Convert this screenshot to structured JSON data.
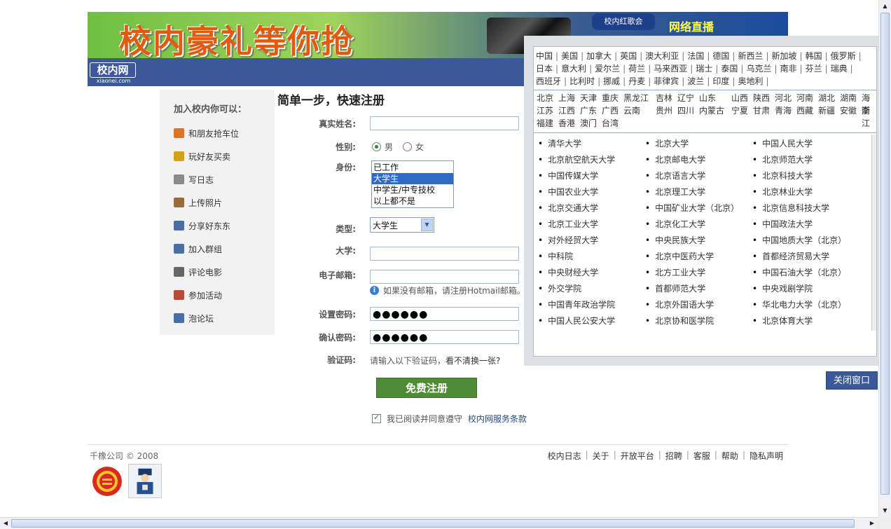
{
  "banner": {
    "text": "校内豪礼等你抢",
    "badge": "校内红歌会",
    "right_text": "网络直播"
  },
  "logo": {
    "main": "校内网",
    "sub": "xiaonei.com"
  },
  "sidebar": {
    "title": "加入校内你可以：",
    "items": [
      {
        "label": "和朋友抢车位",
        "icon": "car-icon",
        "color": "#d9732a"
      },
      {
        "label": "玩好友买卖",
        "icon": "people-trade-icon",
        "color": "#d4a21a"
      },
      {
        "label": "写日志",
        "icon": "notebook-icon",
        "color": "#8a8a8a"
      },
      {
        "label": "上传照片",
        "icon": "photo-icon",
        "color": "#9a6a3a"
      },
      {
        "label": "分享好东东",
        "icon": "share-icon",
        "color": "#4a6fa5"
      },
      {
        "label": "加入群组",
        "icon": "group-icon",
        "color": "#4a6fa5"
      },
      {
        "label": "评论电影",
        "icon": "film-icon",
        "color": "#666666"
      },
      {
        "label": "参加活动",
        "icon": "calendar-icon",
        "color": "#b84a3a"
      },
      {
        "label": "泡论坛",
        "icon": "forum-icon",
        "color": "#4a6fa5"
      }
    ]
  },
  "form": {
    "title": "简单一步，快速注册",
    "labels": {
      "name": "真实姓名:",
      "gender": "性别:",
      "identity": "身份:",
      "type": "类型:",
      "university": "大学:",
      "email": "电子邮箱:",
      "password": "设置密码:",
      "confirm": "确认密码:",
      "captcha": "验证码:"
    },
    "gender_male": "男",
    "gender_female": "女",
    "identity_options": [
      "已工作",
      "大学生",
      "中学生/中专技校",
      "以上都不是"
    ],
    "identity_selected": "大学生",
    "type_value": "大学生",
    "email_hint": "如果没有邮箱，请注册Hotmail邮箱。",
    "password_value": "●●●●●●",
    "confirm_value": "●●●●●●",
    "captcha_text": "请输入以下验证码，",
    "captcha_link": "看不清换一张?",
    "submit": "免费注册",
    "agree_text": "我已阅读并同意遵守",
    "agree_link": "校内网服务条款"
  },
  "footer": {
    "company": "千橡公司 © 2008",
    "links": [
      "校内日志",
      "关于",
      "开放平台",
      "招聘",
      "客服",
      "帮助",
      "隐私声明"
    ]
  },
  "popup": {
    "countries": [
      "中国",
      "美国",
      "加拿大",
      "英国",
      "澳大利亚",
      "法国",
      "德国",
      "新西兰",
      "新加坡",
      "韩国",
      "俄罗斯",
      "日本",
      "意大利",
      "爱尔兰",
      "荷兰",
      "马来西亚",
      "瑞士",
      "泰国",
      "乌克兰",
      "南非",
      "芬兰",
      "瑞典",
      "西班牙",
      "比利时",
      "挪威",
      "丹麦",
      "菲律宾",
      "波兰",
      "印度",
      "奥地利"
    ],
    "provinces": [
      [
        "北京",
        "上海",
        "天津",
        "重庆",
        "黑龙江",
        "吉林",
        "辽宁",
        "山东",
        "山西",
        "陕西",
        "河北",
        "河南",
        "湖北",
        "湖南",
        "海南"
      ],
      [
        "江苏",
        "江西",
        "广东",
        "广西",
        "云南",
        "贵州",
        "四川",
        "内蒙古",
        "宁夏",
        "甘肃",
        "青海",
        "西藏",
        "新疆",
        "安徽",
        "浙江"
      ],
      [
        "福建",
        "香港",
        "澳门",
        "台湾"
      ]
    ],
    "universities": [
      [
        "清华大学",
        "北京大学",
        "中国人民大学"
      ],
      [
        "北京航空航天大学",
        "北京邮电大学",
        "北京师范大学"
      ],
      [
        "中国传媒大学",
        "北京语言大学",
        "北京科技大学"
      ],
      [
        "中国农业大学",
        "北京理工大学",
        "北京林业大学"
      ],
      [
        "北京交通大学",
        "中国矿业大学（北京）",
        "北京信息科技大学"
      ],
      [
        "北京工业大学",
        "北京化工大学",
        "中国政法大学"
      ],
      [
        "对外经贸大学",
        "中央民族大学",
        "中国地质大学（北京）"
      ],
      [
        "中科院",
        "北京中医药大学",
        "首都经济贸易大学"
      ],
      [
        "中央财经大学",
        "北方工业大学",
        "中国石油大学（北京）"
      ],
      [
        "外交学院",
        "首都师范大学",
        "中央戏剧学院"
      ],
      [
        "中国青年政治学院",
        "北京外国语大学",
        "华北电力大学（北京）"
      ],
      [
        "中国人民公安大学",
        "北京协和医学院",
        "北京体育大学"
      ]
    ],
    "close": "关闭窗口"
  }
}
